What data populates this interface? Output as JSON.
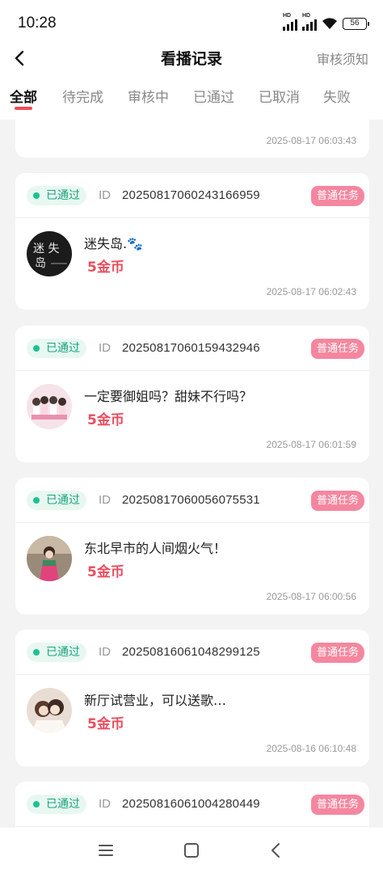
{
  "status_bar": {
    "time": "10:28",
    "battery": "56",
    "hd1": "HD",
    "hd2": "HD"
  },
  "header": {
    "title": "看播记录",
    "help": "审核须知"
  },
  "tabs": [
    {
      "label": "全部"
    },
    {
      "label": "待完成"
    },
    {
      "label": "审核中"
    },
    {
      "label": "已通过"
    },
    {
      "label": "已取消"
    },
    {
      "label": "失败"
    }
  ],
  "records": [
    {
      "time": "2025-08-17 06:03:43"
    },
    {
      "status": "已通过",
      "id_label": "ID",
      "id": "20250817060243166959",
      "task_type": "普通任务",
      "room": "迷失岛.🐾",
      "reward": "5金币",
      "time": "2025-08-17 06:02:43"
    },
    {
      "status": "已通过",
      "id_label": "ID",
      "id": "20250817060159432946",
      "task_type": "普通任务",
      "room": "一定要御姐吗？甜妹不行吗？",
      "reward": "5金币",
      "time": "2025-08-17 06:01:59"
    },
    {
      "status": "已通过",
      "id_label": "ID",
      "id": "20250817060056075531",
      "task_type": "普通任务",
      "room": "东北早市的人间烟火气！",
      "reward": "5金币",
      "time": "2025-08-17 06:00:56"
    },
    {
      "status": "已通过",
      "id_label": "ID",
      "id": "20250816061048299125",
      "task_type": "普通任务",
      "room": "新厅试营业，可以送歌…",
      "reward": "5金币",
      "time": "2025-08-16 06:10:48"
    },
    {
      "status": "已通过",
      "id_label": "ID",
      "id": "20250816061004280449",
      "task_type": "普通任务"
    }
  ],
  "colors": {
    "accent": "#f24a5a",
    "reward": "#ea4d5e",
    "status_green": "#1aa37a",
    "task_pink": "#f4879f"
  }
}
